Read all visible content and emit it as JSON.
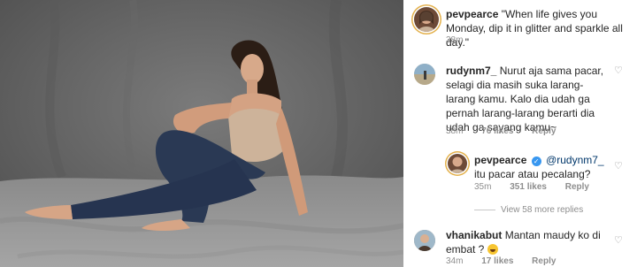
{
  "post": {
    "author": "pevpearce",
    "caption": "\"When life gives you Monday, dip it in glitter and sparkle all day.\"",
    "time": "38m"
  },
  "comments": [
    {
      "user": "rudynm7_",
      "text": "Nurut aja sama pacar, selagi dia masih suka larang-larang kamu. Kalo dia udah ga pernah larang-larang berarti dia udah ga sayang kamu~",
      "time": "38m",
      "likes": "76 likes",
      "reply": "Reply"
    },
    {
      "user": "pevpearce",
      "verified_icon": "verified-badge-icon",
      "mention": "@rudynm7_",
      "text": "itu pacar atau pecalang?",
      "time": "35m",
      "likes": "351 likes",
      "reply": "Reply"
    },
    {
      "user": "vhanikabut",
      "text": "Mantan maudy ko di embat ?",
      "emoji_icon": "grinning-face-emoji",
      "time": "34m",
      "likes": "17 likes",
      "reply": "Reply"
    }
  ],
  "view_more": "View 58 more replies",
  "icons": {
    "like": "heart-outline-icon"
  },
  "colors": {
    "muted": "#8e8e8e",
    "link": "#00376b",
    "verified": "#3897f0",
    "story_ring": "#e3b04b"
  }
}
